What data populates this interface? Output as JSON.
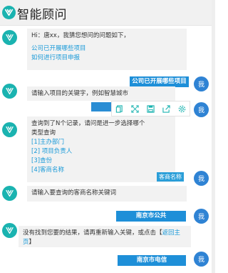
{
  "header": {
    "title": "智能顾问"
  },
  "bot_avatar_icon": "assistant-logo-icon",
  "user_avatar_label": "我",
  "messages": {
    "greeting": "Hi：唐xx，我猜您想问的问题如下，",
    "suggestion_1": "公司已开展哪些项目",
    "suggestion_2": "如何进行项目申报",
    "user_1": "公司已开展哪些项目",
    "prompt_keyword": "请输入项目的关键字，例如智慧城市",
    "found_line1": "查询到了N个记录，请问是进一步选择哪个",
    "found_line2": "类型查询",
    "opt_1": "[1]主办部门",
    "opt_2": "[2] 项目负责人",
    "opt_3": "[3]查份",
    "opt_4": "[4]客商名称",
    "user_2": "客商名称",
    "prompt_customer": "请输入要查询的客商名称关键词",
    "user_3": "南京市公共",
    "no_result": "没有找到您要的结果，请再重新输入关键，或点击【返回主页】",
    "user_4": "南京市电信"
  },
  "toolbar_icons": [
    "copy-icon",
    "expand-icon",
    "save-icon",
    "share-icon",
    "settings-icon"
  ]
}
